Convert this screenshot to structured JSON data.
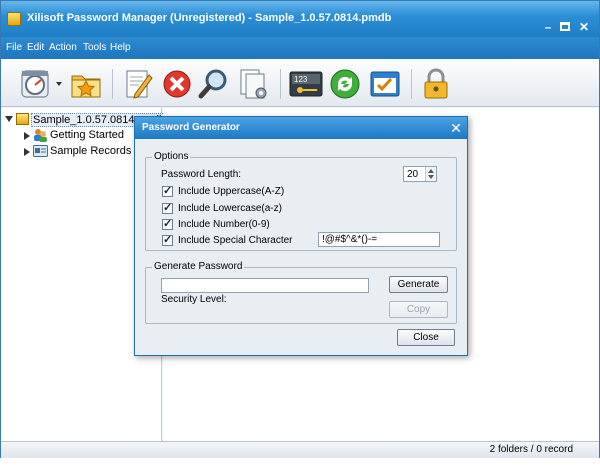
{
  "window": {
    "title": "Xilisoft Password Manager (Unregistered) - Sample_1.0.57.0814.pmdb",
    "minimize_glyph": "–",
    "close_glyph": "✕"
  },
  "menu": [
    "File",
    "Edit",
    "Action",
    "Tools",
    "Help"
  ],
  "toolbar": {
    "icons": [
      "open-database-icon",
      "favorites-icon",
      "edit-icon",
      "delete-icon",
      "search-icon",
      "properties-icon",
      "password-generator-icon",
      "sync-icon",
      "options-icon",
      "lock-icon"
    ]
  },
  "tree": {
    "root": "Sample_1.0.57.0814.pmdb",
    "children": [
      "Getting Started",
      "Sample Records"
    ]
  },
  "status": {
    "text": "2 folders / 0 record"
  },
  "dialog": {
    "title": "Password Generator",
    "close_glyph": "✕",
    "options": {
      "legend": "Options",
      "length_label": "Password Length:",
      "length_value": "20",
      "uppercase_label": "Include Uppercase(A-Z)",
      "lowercase_label": "Include Lowercase(a-z)",
      "number_label": "Include Number(0-9)",
      "special_label": "Include Special Character",
      "special_value": "!@#$^&*()-=",
      "uppercase_checked": true,
      "lowercase_checked": true,
      "number_checked": true,
      "special_checked": true
    },
    "generate": {
      "legend": "Generate Password",
      "password_value": "",
      "generate_button": "Generate",
      "copy_button": "Copy",
      "security_label": "Security Level:"
    },
    "close_button": "Close"
  },
  "colors": {
    "title_bar": "#1f7fc6",
    "dialog_title": "#1c78c4"
  }
}
